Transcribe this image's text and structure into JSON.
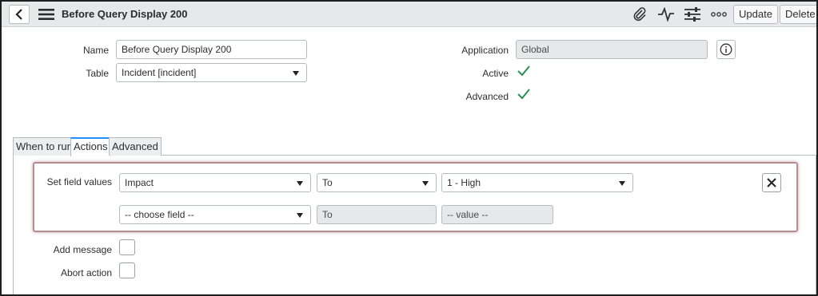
{
  "header": {
    "title": "Before Query Display 200",
    "update_label": "Update",
    "delete_label": "Delete",
    "icons": [
      "back-icon",
      "hamburger-menu-icon",
      "paperclip-icon",
      "activity-icon",
      "settings-sliders-icon",
      "more-options-icon"
    ]
  },
  "form": {
    "name_label": "Name",
    "name_value": "Before Query Display 200",
    "table_label": "Table",
    "table_value": "Incident [incident]",
    "application_label": "Application",
    "application_value": "Global",
    "active_label": "Active",
    "active_checked": true,
    "advanced_label": "Advanced",
    "advanced_checked": true
  },
  "tabs": [
    {
      "label": "When to run",
      "active": false
    },
    {
      "label": "Actions",
      "active": true
    },
    {
      "label": "Advanced",
      "active": false
    }
  ],
  "actions": {
    "set_field_values_label": "Set field values",
    "row1": {
      "field": "Impact",
      "operator": "To",
      "value": "1 - High"
    },
    "row2": {
      "field": "-- choose field --",
      "operator": "To",
      "value": "-- value --"
    },
    "add_message_label": "Add message",
    "abort_action_label": "Abort action"
  },
  "colors": {
    "header_bg": "#e6e8ea",
    "check_green": "#2e8b57",
    "tab_accent": "#278efc",
    "highlight_border": "#b98c92"
  }
}
